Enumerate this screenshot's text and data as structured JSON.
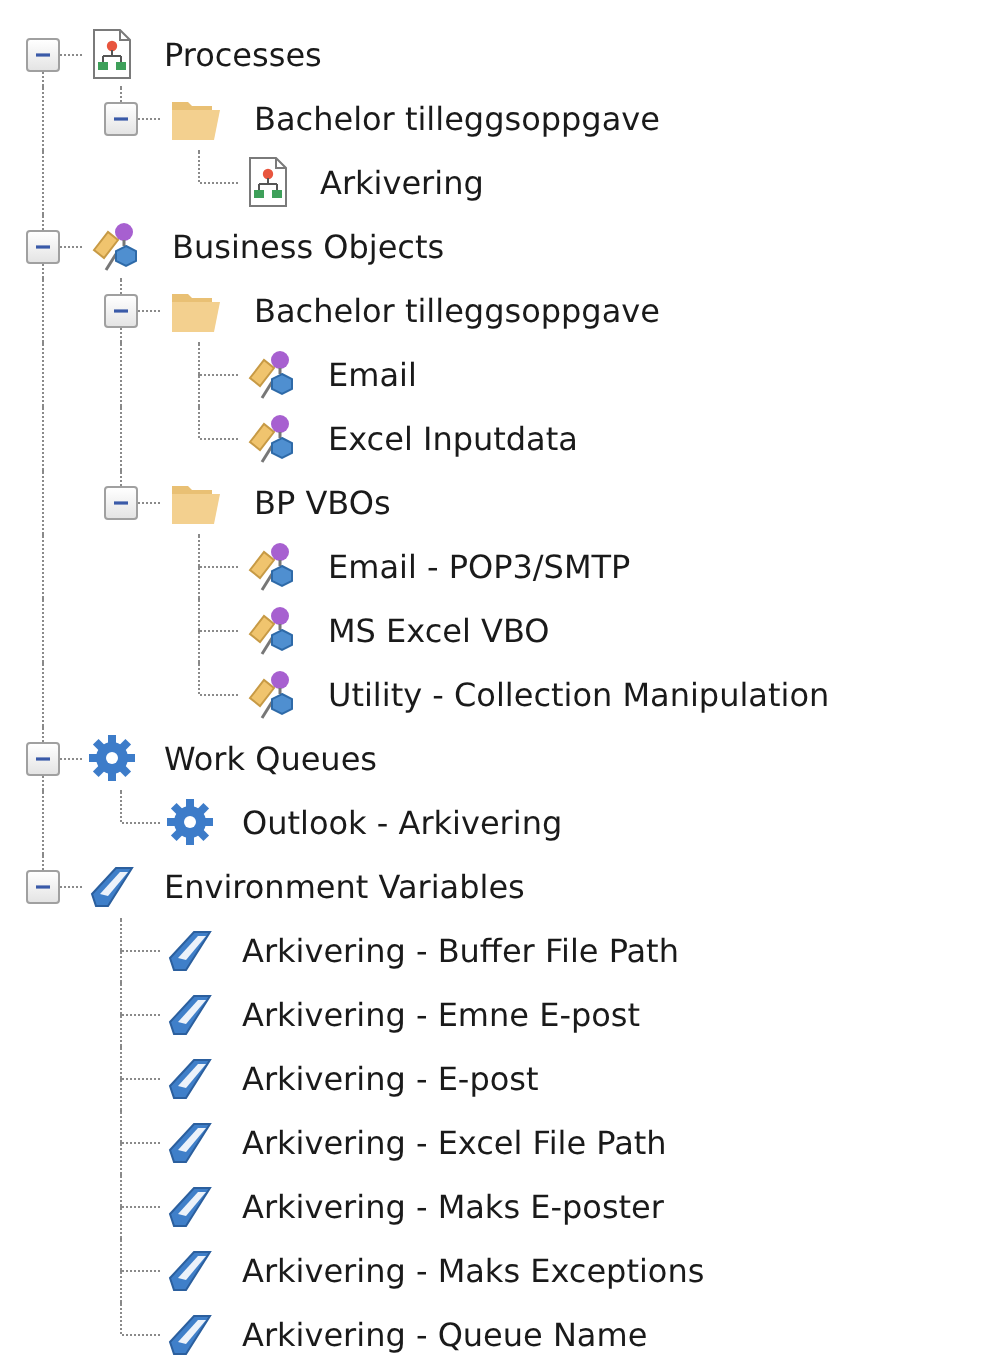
{
  "tree": [
    {
      "label": "Processes",
      "kind": "process",
      "expanded": true,
      "children": [
        {
          "label": "Bachelor tilleggsoppgave",
          "kind": "folder",
          "expanded": true,
          "children": [
            {
              "label": "Arkivering",
              "kind": "process"
            }
          ]
        }
      ]
    },
    {
      "label": "Business Objects",
      "kind": "object",
      "expanded": true,
      "children": [
        {
          "label": "Bachelor tilleggsoppgave",
          "kind": "folder",
          "expanded": true,
          "children": [
            {
              "label": "Email",
              "kind": "object"
            },
            {
              "label": "Excel Inputdata",
              "kind": "object"
            }
          ]
        },
        {
          "label": "BP VBOs",
          "kind": "folder",
          "expanded": true,
          "children": [
            {
              "label": "Email - POP3/SMTP",
              "kind": "object"
            },
            {
              "label": "MS Excel VBO",
              "kind": "object"
            },
            {
              "label": "Utility - Collection Manipulation",
              "kind": "object"
            }
          ]
        }
      ]
    },
    {
      "label": "Work Queues",
      "kind": "queue",
      "expanded": true,
      "children": [
        {
          "label": "Outlook - Arkivering",
          "kind": "queue"
        }
      ]
    },
    {
      "label": "Environment Variables",
      "kind": "variable",
      "expanded": true,
      "children": [
        {
          "label": "Arkivering - Buffer File Path",
          "kind": "variable"
        },
        {
          "label": "Arkivering - Emne E-post",
          "kind": "variable"
        },
        {
          "label": "Arkivering - E-post",
          "kind": "variable"
        },
        {
          "label": "Arkivering - Excel File Path",
          "kind": "variable"
        },
        {
          "label": "Arkivering - Maks E-poster",
          "kind": "variable"
        },
        {
          "label": "Arkivering - Maks Exceptions",
          "kind": "variable"
        },
        {
          "label": "Arkivering - Queue Name",
          "kind": "variable"
        }
      ]
    }
  ]
}
